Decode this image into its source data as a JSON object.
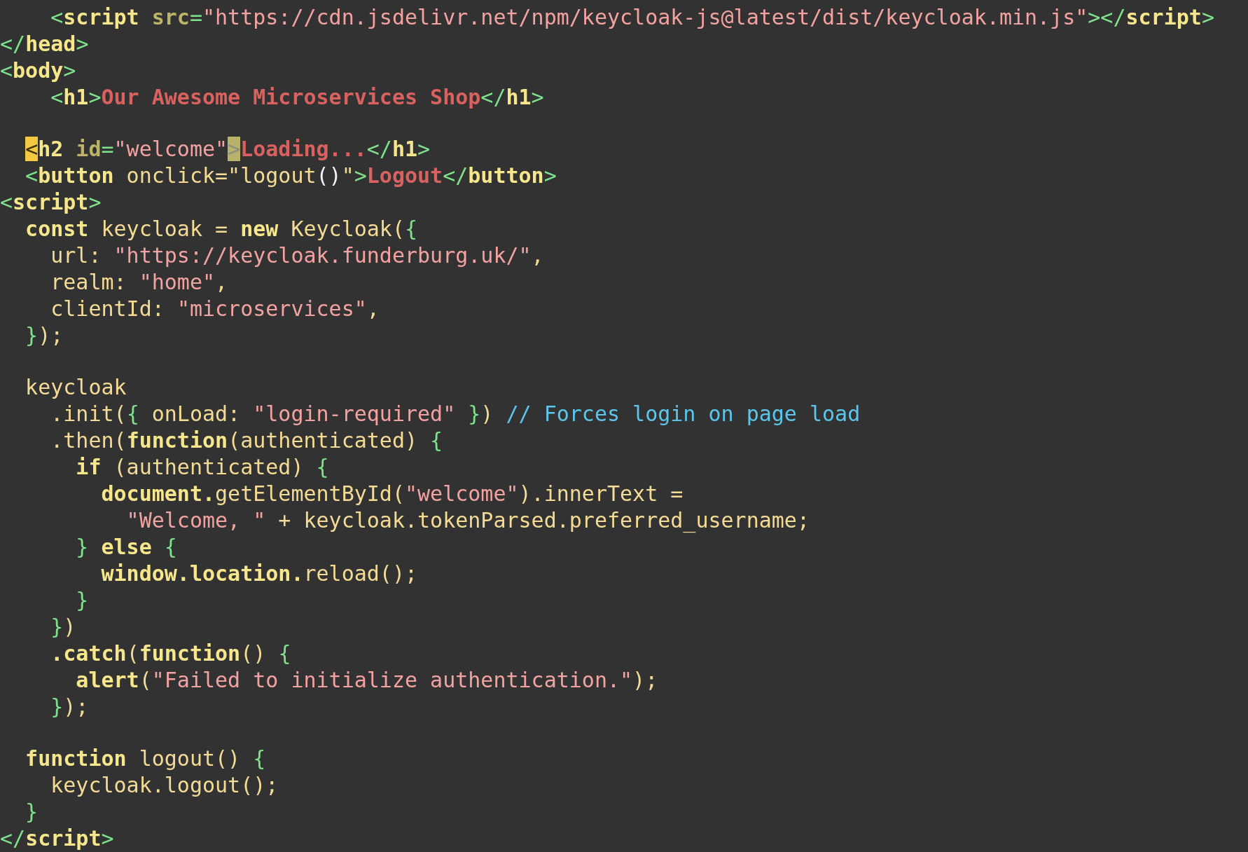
{
  "editor": {
    "lines": [
      {
        "kind": "code",
        "tokens": [
          {
            "text": "    <",
            "kind": "tag"
          },
          {
            "text": "script",
            "kind": "name"
          },
          {
            "text": " src",
            "kind": "attr"
          },
          {
            "text": "=",
            "kind": "tag"
          },
          {
            "text": "\"https://cdn.jsdelivr.net/npm/keycloak-js@latest/dist/keycloak.min.js\"",
            "kind": "str"
          },
          {
            "text": "></",
            "kind": "tag"
          },
          {
            "text": "script",
            "kind": "name"
          },
          {
            "text": ">",
            "kind": "tag"
          }
        ]
      },
      {
        "kind": "code",
        "tokens": [
          {
            "text": "</",
            "kind": "tag"
          },
          {
            "text": "head",
            "kind": "name"
          },
          {
            "text": ">",
            "kind": "tag"
          }
        ]
      },
      {
        "kind": "code",
        "tokens": [
          {
            "text": "<",
            "kind": "tag"
          },
          {
            "text": "body",
            "kind": "name"
          },
          {
            "text": ">",
            "kind": "tag"
          }
        ]
      },
      {
        "kind": "code",
        "tokens": [
          {
            "text": "    <",
            "kind": "tag"
          },
          {
            "text": "h1",
            "kind": "name"
          },
          {
            "text": ">",
            "kind": "tag"
          },
          {
            "text": "Our Awesome Microservices Shop",
            "kind": "content"
          },
          {
            "text": "</",
            "kind": "tag"
          },
          {
            "text": "h1",
            "kind": "name"
          },
          {
            "text": ">",
            "kind": "tag"
          }
        ]
      },
      {
        "kind": "blank"
      },
      {
        "kind": "code",
        "tokens": [
          {
            "text": "  <",
            "kind": "tag",
            "cursor": true
          },
          {
            "text": "h2",
            "kind": "name"
          },
          {
            "text": " id",
            "kind": "attr"
          },
          {
            "text": "=",
            "kind": "tag"
          },
          {
            "text": "\"welcome\"",
            "kind": "str"
          },
          {
            "text": ">",
            "kind": "tag",
            "bracket_match": true
          },
          {
            "text": "Loading...",
            "kind": "content"
          },
          {
            "text": "</",
            "kind": "tag"
          },
          {
            "text": "h1",
            "kind": "name"
          },
          {
            "text": ">",
            "kind": "tag"
          }
        ]
      },
      {
        "kind": "code",
        "tokens": [
          {
            "text": "  <",
            "kind": "tag"
          },
          {
            "text": "button",
            "kind": "name"
          },
          {
            "text": " onclick=\"logout",
            "kind": "plain"
          },
          {
            "text": "()",
            "kind": "punct"
          },
          {
            "text": "\"",
            "kind": "plain"
          },
          {
            "text": ">",
            "kind": "tag"
          },
          {
            "text": "Logout",
            "kind": "content"
          },
          {
            "text": "</",
            "kind": "tag"
          },
          {
            "text": "button",
            "kind": "name"
          },
          {
            "text": ">",
            "kind": "tag"
          }
        ]
      },
      {
        "kind": "code",
        "tokens": [
          {
            "text": "<",
            "kind": "tag"
          },
          {
            "text": "script",
            "kind": "name"
          },
          {
            "text": ">",
            "kind": "tag"
          }
        ]
      },
      {
        "kind": "code",
        "tokens": [
          {
            "text": "  const",
            "kind": "kw"
          },
          {
            "text": " keycloak = ",
            "kind": "plain"
          },
          {
            "text": "new",
            "kind": "kw"
          },
          {
            "text": " Keycloak(",
            "kind": "plain"
          },
          {
            "text": "{",
            "kind": "brace"
          }
        ]
      },
      {
        "kind": "code",
        "tokens": [
          {
            "text": "    url: ",
            "kind": "plain"
          },
          {
            "text": "\"https://keycloak.funderburg.uk/\"",
            "kind": "str"
          },
          {
            "text": ",",
            "kind": "plain"
          }
        ]
      },
      {
        "kind": "code",
        "tokens": [
          {
            "text": "    realm: ",
            "kind": "plain"
          },
          {
            "text": "\"home\"",
            "kind": "str"
          },
          {
            "text": ",",
            "kind": "plain"
          }
        ]
      },
      {
        "kind": "code",
        "tokens": [
          {
            "text": "    clientId: ",
            "kind": "plain"
          },
          {
            "text": "\"microservices\"",
            "kind": "str"
          },
          {
            "text": ",",
            "kind": "plain"
          }
        ]
      },
      {
        "kind": "code",
        "tokens": [
          {
            "text": "  }",
            "kind": "brace"
          },
          {
            "text": ");",
            "kind": "plain"
          }
        ]
      },
      {
        "kind": "blank"
      },
      {
        "kind": "code",
        "tokens": [
          {
            "text": "  keycloak",
            "kind": "plain"
          }
        ]
      },
      {
        "kind": "code",
        "tokens": [
          {
            "text": "    .init(",
            "kind": "plain"
          },
          {
            "text": "{",
            "kind": "brace"
          },
          {
            "text": " onLoad: ",
            "kind": "plain"
          },
          {
            "text": "\"login-required\"",
            "kind": "str"
          },
          {
            "text": " }",
            "kind": "brace"
          },
          {
            "text": ") ",
            "kind": "plain"
          },
          {
            "text": "// Forces login on page load",
            "kind": "comment"
          }
        ]
      },
      {
        "kind": "code",
        "tokens": [
          {
            "text": "    .then(",
            "kind": "plain"
          },
          {
            "text": "function",
            "kind": "kw"
          },
          {
            "text": "(authenticated) ",
            "kind": "plain"
          },
          {
            "text": "{",
            "kind": "brace"
          }
        ]
      },
      {
        "kind": "code",
        "tokens": [
          {
            "text": "      if",
            "kind": "kw"
          },
          {
            "text": " (authenticated) ",
            "kind": "plain"
          },
          {
            "text": "{",
            "kind": "brace"
          }
        ]
      },
      {
        "kind": "code",
        "tokens": [
          {
            "text": "        document.",
            "kind": "kw"
          },
          {
            "text": "getElementById(",
            "kind": "plain"
          },
          {
            "text": "\"welcome\"",
            "kind": "str"
          },
          {
            "text": ").innerText =",
            "kind": "plain"
          }
        ]
      },
      {
        "kind": "code",
        "tokens": [
          {
            "text": "          \"Welcome, \"",
            "kind": "str"
          },
          {
            "text": " + keycloak.tokenParsed.preferred_username;",
            "kind": "plain"
          }
        ]
      },
      {
        "kind": "code",
        "tokens": [
          {
            "text": "      }",
            "kind": "brace"
          },
          {
            "text": " else ",
            "kind": "kw"
          },
          {
            "text": "{",
            "kind": "brace"
          }
        ]
      },
      {
        "kind": "code",
        "tokens": [
          {
            "text": "        window.location.",
            "kind": "kw"
          },
          {
            "text": "reload();",
            "kind": "plain"
          }
        ]
      },
      {
        "kind": "code",
        "tokens": [
          {
            "text": "      }",
            "kind": "brace"
          }
        ]
      },
      {
        "kind": "code",
        "tokens": [
          {
            "text": "    }",
            "kind": "brace"
          },
          {
            "text": ")",
            "kind": "plain"
          }
        ]
      },
      {
        "kind": "code",
        "tokens": [
          {
            "text": "    .catch",
            "kind": "kw"
          },
          {
            "text": "(",
            "kind": "plain"
          },
          {
            "text": "function",
            "kind": "kw"
          },
          {
            "text": "() ",
            "kind": "plain"
          },
          {
            "text": "{",
            "kind": "brace"
          }
        ]
      },
      {
        "kind": "code",
        "tokens": [
          {
            "text": "      alert",
            "kind": "kw"
          },
          {
            "text": "(",
            "kind": "plain"
          },
          {
            "text": "\"Failed to initialize authentication.\"",
            "kind": "str"
          },
          {
            "text": ");",
            "kind": "plain"
          }
        ]
      },
      {
        "kind": "code",
        "tokens": [
          {
            "text": "    }",
            "kind": "brace"
          },
          {
            "text": ");",
            "kind": "plain"
          }
        ]
      },
      {
        "kind": "blank"
      },
      {
        "kind": "code",
        "tokens": [
          {
            "text": "  function",
            "kind": "kw"
          },
          {
            "text": " logout() ",
            "kind": "plain"
          },
          {
            "text": "{",
            "kind": "brace"
          }
        ]
      },
      {
        "kind": "code",
        "tokens": [
          {
            "text": "    keycloak.logout();",
            "kind": "plain"
          }
        ]
      },
      {
        "kind": "code",
        "tokens": [
          {
            "text": "  }",
            "kind": "brace"
          }
        ]
      },
      {
        "kind": "code",
        "tokens": [
          {
            "text": "</",
            "kind": "tag"
          },
          {
            "text": "script",
            "kind": "name"
          },
          {
            "text": ">",
            "kind": "tag"
          }
        ]
      }
    ]
  }
}
